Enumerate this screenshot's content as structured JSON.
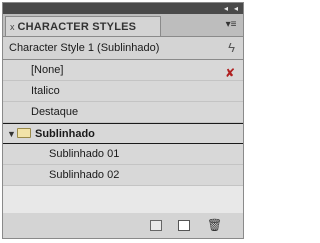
{
  "panel": {
    "title": "CHARACTER STYLES",
    "current_style": "Character Style 1 (Sublinhado)"
  },
  "icons": {
    "collapse_left": "◂",
    "collapse_right": "◂",
    "tab_close": "x",
    "panel_menu": "▾≡",
    "lightning": "ϟ",
    "no_style": "✘",
    "triangle_open": "▼",
    "trash": "🗑"
  },
  "styles": [
    {
      "label": "[None]",
      "level": 1
    },
    {
      "label": "Italico",
      "level": 1
    },
    {
      "label": "Destaque",
      "level": 1
    },
    {
      "label": "Sublinhado",
      "level": 0,
      "type": "group",
      "expanded": true
    },
    {
      "label": "Sublinhado 01",
      "level": 2
    },
    {
      "label": "Sublinhado 02",
      "level": 2
    }
  ]
}
